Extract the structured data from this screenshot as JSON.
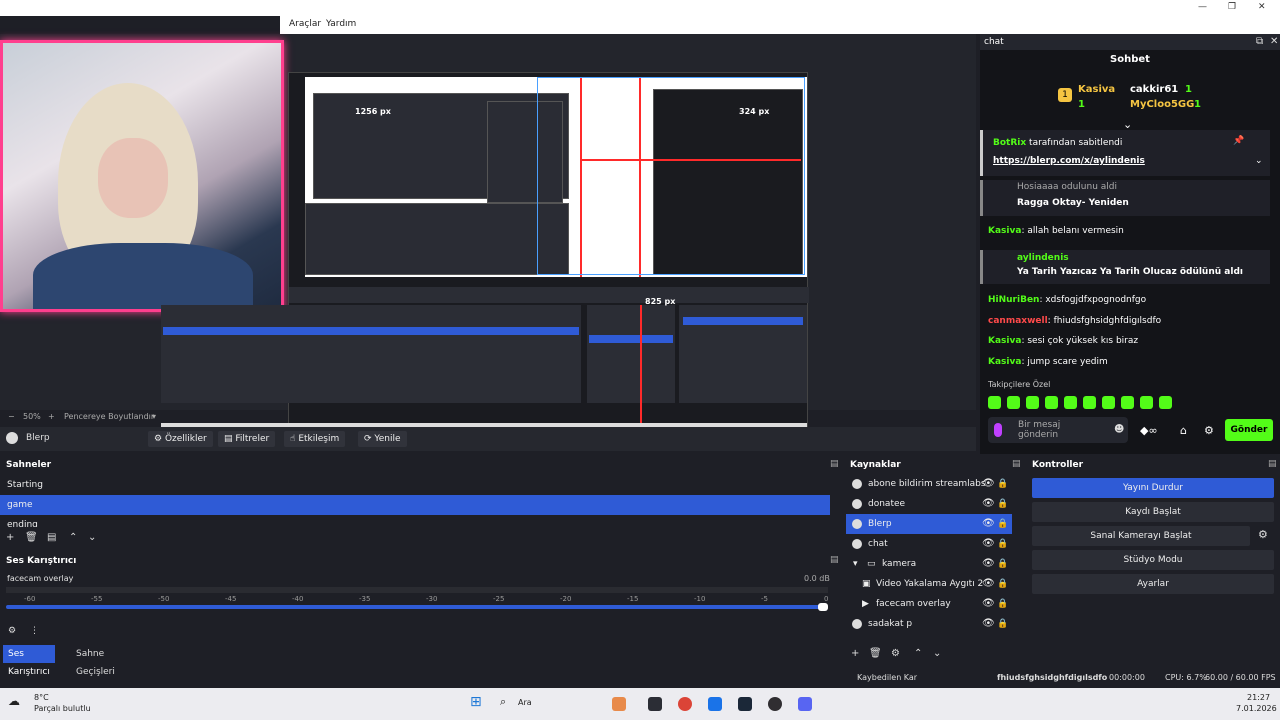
{
  "menu": {
    "items": [
      "Araçlar",
      "Yardım"
    ],
    "window_controls": [
      "—",
      "❐",
      "✕"
    ]
  },
  "preview": {
    "measure_top": "324 px",
    "measure_right": "825 px",
    "nested_measure": "1256 px",
    "zoom": "50%",
    "fit_mode": "Pencereye Boyutlandır"
  },
  "chat": {
    "dock_title": "chat",
    "title": "Sohbet",
    "leaders": [
      {
        "rank": "1",
        "name": "Kasiva",
        "count": "1"
      },
      {
        "name": "cakkir61",
        "count": "1"
      },
      {
        "name": "MyCloo5GG",
        "count": "1"
      }
    ],
    "pinned_by": "BotRix",
    "pinned_text": "tarafından sabitlendi",
    "pinned_link": "https://blerp.com/x/aylindenis",
    "reward1_cut": "Hosiaaaa odulunu aldi",
    "reward1_name": "Ragga Oktay- Yeniden",
    "messages": [
      {
        "user": "Kasiva",
        "text": "allah belanı vermesin",
        "color": "lime"
      },
      {
        "user": "HiNuriBen",
        "text": "xdsfogjdfxpognodnfgo",
        "color": "lime"
      },
      {
        "user": "canmaxwell",
        "text": "fhiudsfghsidghfdigılsdfo",
        "color": "red"
      },
      {
        "user": "Kasiva",
        "text": "sesi çok yüksek kıs biraz",
        "color": "lime"
      },
      {
        "user": "Kasiva",
        "text": "jump scare yedim",
        "color": "lime"
      }
    ],
    "reward2_user": "aylindenis",
    "reward2_text": "Ya Tarih Yazıcaz Ya Tarih Olucaz ödülünü aldı",
    "followers_only": "Takipçilere Özel",
    "input_placeholder": "Bir mesaj gönderin",
    "send_label": "Gönder"
  },
  "source_toolbar": {
    "source_name": "Blerp",
    "buttons": [
      "Özellikler",
      "Filtreler",
      "Etkileşim",
      "Yenile"
    ]
  },
  "scenes": {
    "title": "Sahneler",
    "items": [
      "Starting",
      "game",
      "ending"
    ],
    "selected": "game"
  },
  "sources": {
    "title": "Kaynaklar",
    "items": [
      "abone bildirim streamlabs",
      "donatee",
      "Blerp",
      "chat",
      "kamera",
      "Video Yakalama Aygıtı 2",
      "facecam overlay",
      "sadakat p"
    ],
    "selected": "Blerp"
  },
  "controls": {
    "title": "Kontroller",
    "buttons": [
      "Yayını Durdur",
      "Kaydı Başlat",
      "Sanal Kamerayı Başlat",
      "Stüdyo Modu",
      "Ayarlar"
    ]
  },
  "mixer": {
    "title": "Ses Karıştırıcı",
    "track_name": "facecam overlay",
    "level": "0.0 dB",
    "ticks": [
      "-60",
      "-55",
      "-50",
      "-45",
      "-40",
      "-35",
      "-30",
      "-25",
      "-20",
      "-15",
      "-10",
      "-5",
      "0"
    ]
  },
  "bottom_tabs": [
    "Ses Karıştırıcı",
    "Sahne Geçişleri"
  ],
  "status": {
    "dropped": "Kaybedilen Kar",
    "time": "00:00:00",
    "cpu": "CPU: 6.7%",
    "fps": "60.00 / 60.00 FPS",
    "overlay": "fhiudsfghsidghfdigılsdfo"
  },
  "taskbar": {
    "weather_temp": "8°C",
    "weather_desc": "Parçalı bulutlu",
    "search": "Ara",
    "clock": "21:27",
    "date": "7.01.2026",
    "icon_colors": [
      "#1e90ff",
      "#ff8c00",
      "#4a90e2",
      "#1a73e8",
      "#2b2d35",
      "#6a5acd"
    ]
  }
}
